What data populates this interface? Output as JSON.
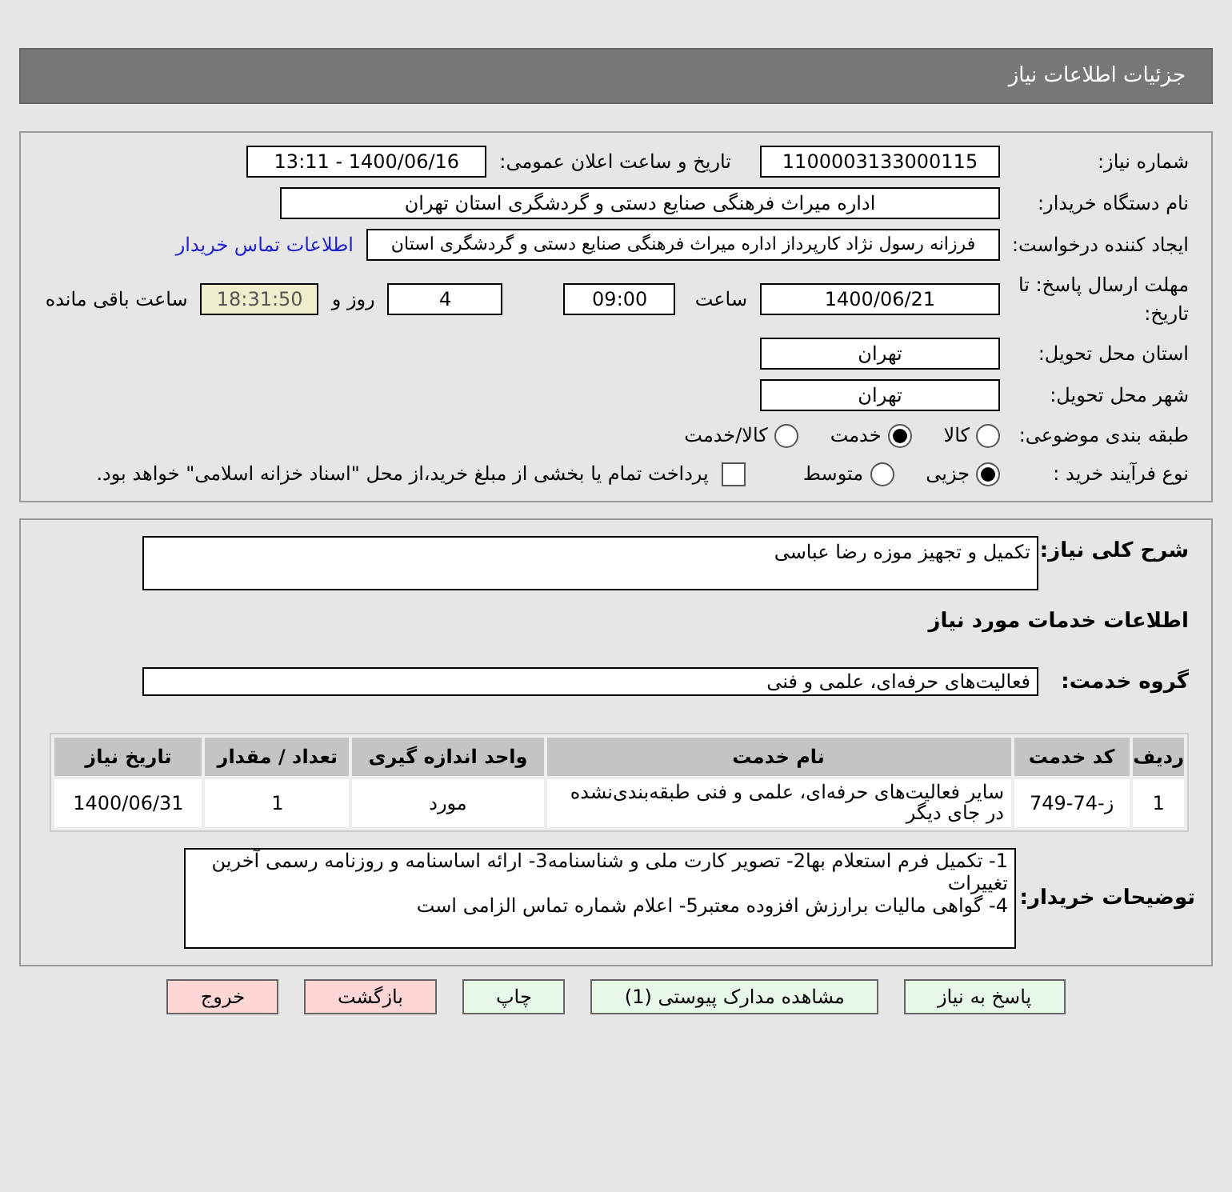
{
  "header": {
    "title": "جزئیات اطلاعات نیاز"
  },
  "details": {
    "need_number": {
      "label": "شماره نیاز:",
      "value": "1100003133000115"
    },
    "announce": {
      "label": "تاریخ و ساعت اعلان عمومی:",
      "value": "1400/06/16 - 13:11"
    },
    "buyer_org": {
      "label": "نام دستگاه خریدار:",
      "value": "اداره میراث فرهنگی  صنایع دستی و گردشگری استان تهران"
    },
    "creator": {
      "label": "ایجاد کننده درخواست:",
      "value": "فرزانه رسول نژاد کارپرداز اداره میراث فرهنگی  صنایع دستی و گردشگری استان",
      "link": "اطلاعات تماس خریدار"
    },
    "deadline": {
      "label": "مهلت ارسال پاسخ: تا تاریخ:",
      "date": "1400/06/21",
      "time_label": "ساعت",
      "time": "09:00",
      "days": "4",
      "days_label": "روز و",
      "remaining": "18:31:50",
      "remaining_label": "ساعت باقی مانده"
    },
    "province": {
      "label": "استان محل تحویل:",
      "value": "تهران"
    },
    "city": {
      "label": "شهر محل تحویل:",
      "value": "تهران"
    },
    "category": {
      "label": "طبقه بندی موضوعی:",
      "options": [
        {
          "label": "کالا",
          "selected": false
        },
        {
          "label": "خدمت",
          "selected": true
        },
        {
          "label": "کالا/خدمت",
          "selected": false
        }
      ]
    },
    "process": {
      "label": "نوع فرآیند خرید :",
      "options": [
        {
          "label": "جزیی",
          "selected": true
        },
        {
          "label": "متوسط",
          "selected": false
        }
      ],
      "payment": {
        "label": "پرداخت تمام یا بخشی از مبلغ خرید،از محل \"اسناد خزانه اسلامی\" خواهد بود.",
        "checked": false
      }
    }
  },
  "need": {
    "summary_label": "شرح کلی نیاز:",
    "summary": "تکمیل و تجهیز موزه رضا عباسی",
    "services_heading": "اطلاعات خدمات مورد نیاز",
    "group_label": "گروه خدمت:",
    "group": "فعالیت‌های حرفه‌ای، علمی و فنی",
    "table": {
      "columns": [
        "ردیف",
        "کد خدمت",
        "نام خدمت",
        "واحد اندازه گیری",
        "تعداد / مقدار",
        "تاریخ نیاز"
      ],
      "rows": [
        [
          "1",
          "ز-74-749",
          "سایر فعالیت‌های حرفه‌ای، علمی و فنی طبقه‌بندی‌نشده در جای دیگر",
          "مورد",
          "1",
          "1400/06/31"
        ]
      ]
    },
    "notes_label": "توضیحات خریدار:",
    "notes": "1- تکمیل فرم استعلام بها2- تصویر کارت ملی و شناسنامه3- ارائه اساسنامه و روزنامه رسمی آخرین تغییرات\n4- گواهی مالیات برارزش افزوده معتبر5- اعلام شماره تماس الزامی است"
  },
  "buttons": [
    {
      "label": "پاسخ به نیاز",
      "kind": "normal"
    },
    {
      "label": "مشاهده مدارک پیوستی (1)",
      "kind": "normal"
    },
    {
      "label": "چاپ",
      "kind": "normal"
    },
    {
      "label": "بازگشت",
      "kind": "warn"
    },
    {
      "label": "خروج",
      "kind": "warn"
    }
  ]
}
